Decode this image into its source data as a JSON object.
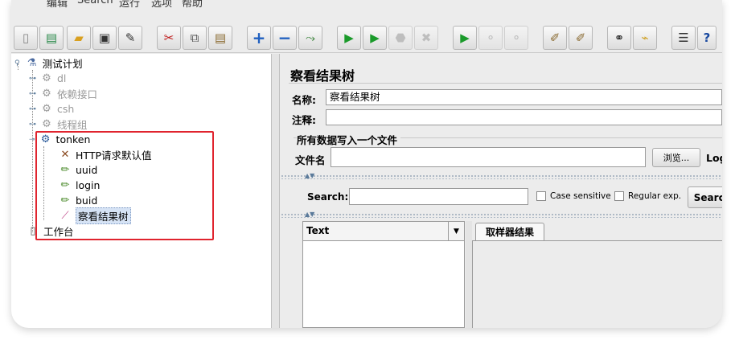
{
  "menubar": {
    "items": [
      "编辑",
      "Search",
      "运行",
      "选项",
      "帮助"
    ]
  },
  "toolbar": {
    "buttons": [
      {
        "icon": "new-icon",
        "glyph": "▯"
      },
      {
        "icon": "templates-icon",
        "glyph": "▤"
      },
      {
        "icon": "open-icon",
        "glyph": "📂"
      },
      {
        "icon": "save-icon",
        "glyph": "💾"
      },
      {
        "icon": "save-as-icon",
        "glyph": "✎"
      },
      {
        "icon": "cut-icon",
        "glyph": "✂"
      },
      {
        "icon": "copy-icon",
        "glyph": "⧉"
      },
      {
        "icon": "paste-icon",
        "glyph": "📋"
      },
      {
        "icon": "expand-icon",
        "glyph": "+"
      },
      {
        "icon": "collapse-icon",
        "glyph": "−"
      },
      {
        "icon": "toggle-icon",
        "glyph": "⤳"
      },
      {
        "icon": "start-icon",
        "glyph": "▶"
      },
      {
        "icon": "start-no-pause-icon",
        "glyph": "▶"
      },
      {
        "icon": "stop-icon",
        "glyph": "⬣"
      },
      {
        "icon": "shutdown-icon",
        "glyph": "✖"
      },
      {
        "icon": "remote-start-icon",
        "glyph": "▶"
      },
      {
        "icon": "remote-stop-icon",
        "glyph": "⚬"
      },
      {
        "icon": "remote-shutdown-icon",
        "glyph": "⚬"
      },
      {
        "icon": "clear-icon",
        "glyph": "✐"
      },
      {
        "icon": "clear-all-icon",
        "glyph": "✐"
      },
      {
        "icon": "search-binoculars-icon",
        "glyph": "⚭"
      },
      {
        "icon": "reset-search-icon",
        "glyph": "⌁"
      },
      {
        "icon": "function-helper-icon",
        "glyph": "☰"
      },
      {
        "icon": "help-icon",
        "glyph": "?"
      }
    ]
  },
  "tree": {
    "root": "测试计划",
    "items": [
      {
        "label": "dl",
        "disabled": true,
        "icon": "gear-icon"
      },
      {
        "label": "依赖接口",
        "disabled": true,
        "icon": "gear-icon"
      },
      {
        "label": "csh",
        "disabled": true,
        "icon": "gear-icon"
      },
      {
        "label": "线程组",
        "disabled": true,
        "icon": "gear-icon"
      },
      {
        "label": "tonken",
        "disabled": false,
        "icon": "gear-icon"
      }
    ],
    "children": [
      {
        "label": "HTTP请求默认值",
        "icon": "wrench-icon"
      },
      {
        "label": "uuid",
        "icon": "sampler-pen-icon"
      },
      {
        "label": "login",
        "icon": "sampler-pen-icon"
      },
      {
        "label": "buid",
        "icon": "sampler-pen-icon"
      },
      {
        "label": "察看结果树",
        "icon": "listener-chart-icon"
      }
    ],
    "workbench": "工作台"
  },
  "panel": {
    "title": "察看结果树",
    "name_label": "名称:",
    "name_value": "察看结果树",
    "comment_label": "注释:",
    "comment_value": "",
    "group_title": "所有数据写入一个文件",
    "filename_label": "文件名",
    "filename_value": "",
    "browse_label": "浏览...",
    "log_label": "Log"
  },
  "search": {
    "label": "Search:",
    "value": "",
    "case_sensitive": "Case sensitive",
    "regex": "Regular exp.",
    "button": "Search"
  },
  "results": {
    "renderer": "Text",
    "tab": "取样器结果"
  }
}
